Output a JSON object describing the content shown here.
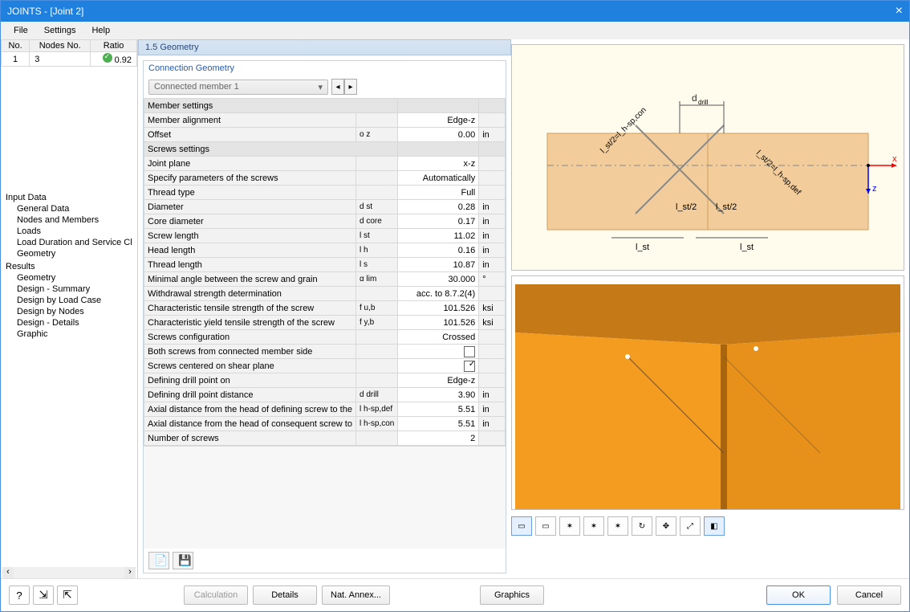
{
  "window": {
    "title": "JOINTS - [Joint 2]"
  },
  "menu": {
    "file": "File",
    "settings": "Settings",
    "help": "Help"
  },
  "caseTable": {
    "headers": {
      "no": "No.",
      "nodes": "Nodes No.",
      "ratio": "Ratio"
    },
    "row": {
      "no": "1",
      "nodes": "3",
      "ratio": "0.92"
    }
  },
  "tree": {
    "input": {
      "title": "Input Data",
      "items": [
        "General Data",
        "Nodes and Members",
        "Loads",
        "Load Duration and Service Class",
        "Geometry"
      ]
    },
    "results": {
      "title": "Results",
      "items": [
        "Geometry",
        "Design - Summary",
        "Design by Load Case",
        "Design by Nodes",
        "Design - Details",
        "Graphic"
      ]
    }
  },
  "header": {
    "title": "1.5 Geometry"
  },
  "propbox": {
    "title": "Connection Geometry",
    "combo": "Connected member 1"
  },
  "rows": {
    "member_settings": "Member settings",
    "member_alignment": {
      "l": "Member alignment",
      "v": "Edge-z"
    },
    "offset": {
      "l": "Offset",
      "s": "o z",
      "v": "0.00",
      "u": "in"
    },
    "screws_settings": "Screws settings",
    "joint_plane": {
      "l": "Joint plane",
      "v": "x-z"
    },
    "specify_params": {
      "l": "Specify parameters of the screws",
      "v": "Automatically"
    },
    "thread_type": {
      "l": "Thread type",
      "v": "Full"
    },
    "diameter": {
      "l": "Diameter",
      "s": "d st",
      "v": "0.28",
      "u": "in"
    },
    "core_diameter": {
      "l": "Core diameter",
      "s": "d core",
      "v": "0.17",
      "u": "in"
    },
    "screw_length": {
      "l": "Screw length",
      "s": "l st",
      "v": "11.02",
      "u": "in"
    },
    "head_length": {
      "l": "Head length",
      "s": "l h",
      "v": "0.16",
      "u": "in"
    },
    "thread_length": {
      "l": "Thread length",
      "s": "l s",
      "v": "10.87",
      "u": "in"
    },
    "min_angle": {
      "l": "Minimal angle between the screw and grain",
      "s": "α lim",
      "v": "30.000",
      "u": "°"
    },
    "withdrawal": {
      "l": "Withdrawal strength determination",
      "v": "acc. to 8.7.2(4)"
    },
    "char_tensile": {
      "l": "Characteristic tensile strength of the screw",
      "s": "f u,b",
      "v": "101.526",
      "u": "ksi"
    },
    "char_yield": {
      "l": "Characteristic yield tensile strength of the screw",
      "s": "f y,b",
      "v": "101.526",
      "u": "ksi"
    },
    "screws_config": {
      "l": "Screws configuration",
      "v": "Crossed"
    },
    "both_screws": {
      "l": "Both screws from connected member side"
    },
    "centered": {
      "l": "Screws centered on shear plane"
    },
    "def_drill_on": {
      "l": "Defining drill point on",
      "v": "Edge-z"
    },
    "def_drill_dist": {
      "l": "Defining drill point distance",
      "s": "d drill",
      "v": "3.90",
      "u": "in"
    },
    "axial_def": {
      "l": "Axial distance from the head of defining screw to the",
      "s": "l h-sp,def",
      "v": "5.51",
      "u": "in"
    },
    "axial_con": {
      "l": "Axial distance from the head of consequent screw to",
      "s": "l h-sp,con",
      "v": "5.51",
      "u": "in"
    },
    "num_screws": {
      "l": "Number of screws",
      "v": "2"
    }
  },
  "diagram": {
    "ddrill": "d_drill",
    "lst2_con": "l_st/2=l_h-sp,con",
    "lst2_def": "l_st/2=l_h-sp,def",
    "lst2": "l_st/2",
    "lst": "l_st",
    "x": "x",
    "z": "z"
  },
  "footer": {
    "calculation": "Calculation",
    "details": "Details",
    "nat_annex": "Nat. Annex...",
    "graphics": "Graphics",
    "ok": "OK",
    "cancel": "Cancel"
  }
}
